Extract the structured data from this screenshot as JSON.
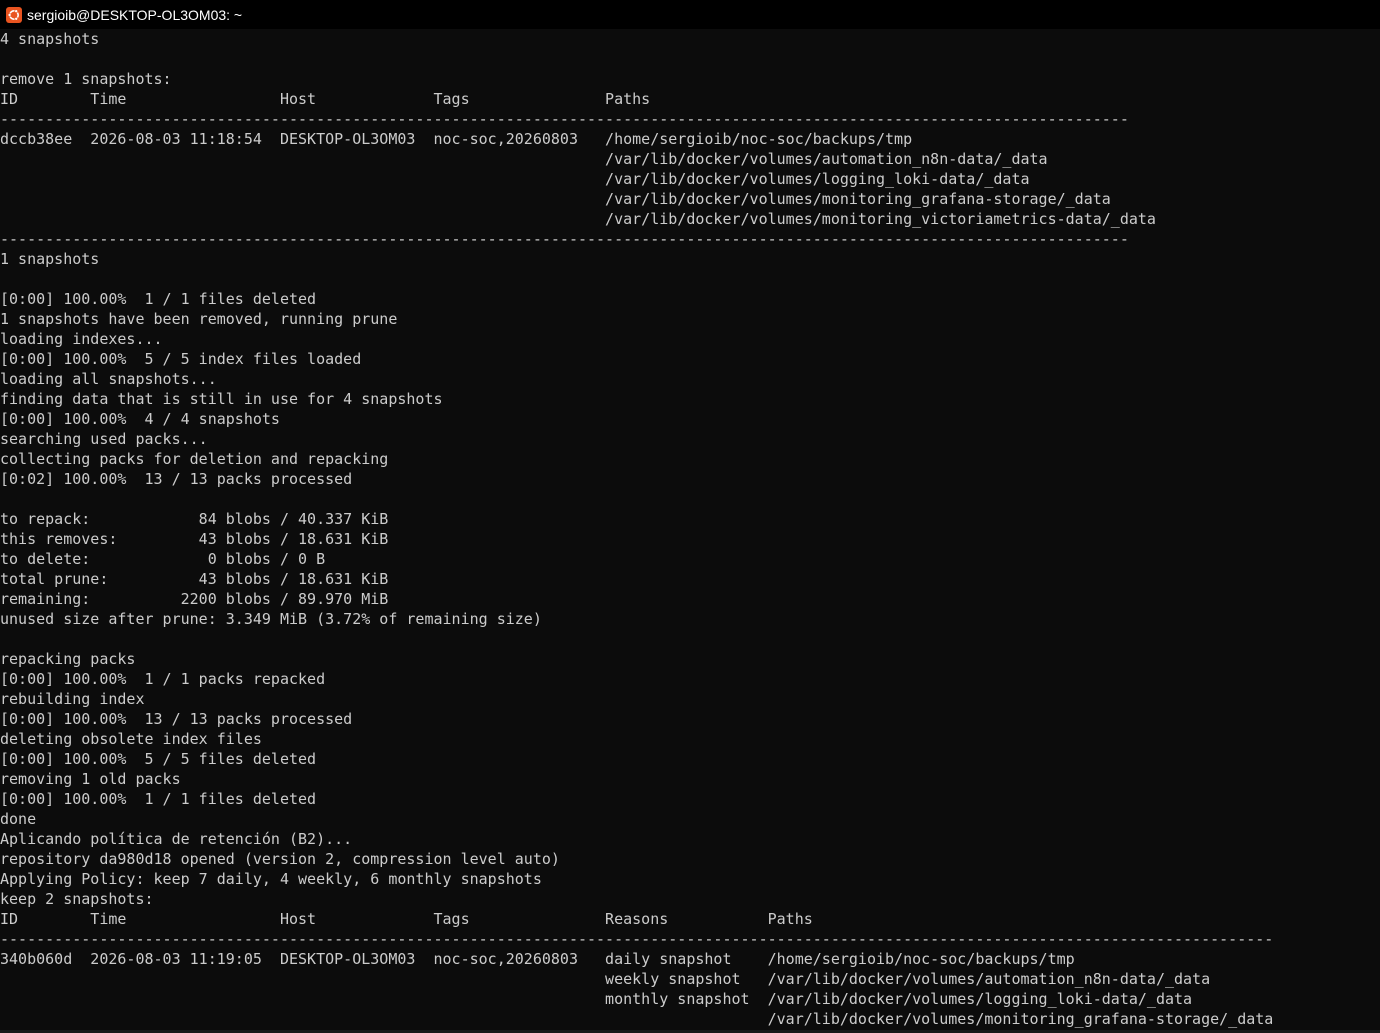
{
  "window": {
    "title": "sergioib@DESKTOP-OL3OM03: ~",
    "icon": "ubuntu-icon",
    "accent": "#e95420",
    "background": "#0c0c0c",
    "foreground": "#cccccc"
  },
  "lines": [
    "4 snapshots",
    "",
    "remove 1 snapshots:",
    "ID        Time                 Host             Tags               Paths",
    "-----------------------------------------------------------------------------------------------------------------------------",
    "dccb38ee  2026-08-03 11:18:54  DESKTOP-OL3OM03  noc-soc,20260803   /home/sergioib/noc-soc/backups/tmp",
    "                                                                   /var/lib/docker/volumes/automation_n8n-data/_data",
    "                                                                   /var/lib/docker/volumes/logging_loki-data/_data",
    "                                                                   /var/lib/docker/volumes/monitoring_grafana-storage/_data",
    "                                                                   /var/lib/docker/volumes/monitoring_victoriametrics-data/_data",
    "-----------------------------------------------------------------------------------------------------------------------------",
    "1 snapshots",
    "",
    "[0:00] 100.00%  1 / 1 files deleted",
    "1 snapshots have been removed, running prune",
    "loading indexes...",
    "[0:00] 100.00%  5 / 5 index files loaded",
    "loading all snapshots...",
    "finding data that is still in use for 4 snapshots",
    "[0:00] 100.00%  4 / 4 snapshots",
    "searching used packs...",
    "collecting packs for deletion and repacking",
    "[0:02] 100.00%  13 / 13 packs processed",
    "",
    "to repack:            84 blobs / 40.337 KiB",
    "this removes:         43 blobs / 18.631 KiB",
    "to delete:             0 blobs / 0 B",
    "total prune:          43 blobs / 18.631 KiB",
    "remaining:          2200 blobs / 89.970 MiB",
    "unused size after prune: 3.349 MiB (3.72% of remaining size)",
    "",
    "repacking packs",
    "[0:00] 100.00%  1 / 1 packs repacked",
    "rebuilding index",
    "[0:00] 100.00%  13 / 13 packs processed",
    "deleting obsolete index files",
    "[0:00] 100.00%  5 / 5 files deleted",
    "removing 1 old packs",
    "[0:00] 100.00%  1 / 1 files deleted",
    "done",
    "Aplicando política de retención (B2)...",
    "repository da980d18 opened (version 2, compression level auto)",
    "Applying Policy: keep 7 daily, 4 weekly, 6 monthly snapshots",
    "keep 2 snapshots:",
    "ID        Time                 Host             Tags               Reasons           Paths",
    "---------------------------------------------------------------------------------------------------------------------------------------------",
    "340b060d  2026-08-03 11:19:05  DESKTOP-OL3OM03  noc-soc,20260803   daily snapshot    /home/sergioib/noc-soc/backups/tmp",
    "                                                                   weekly snapshot   /var/lib/docker/volumes/automation_n8n-data/_data",
    "                                                                   monthly snapshot  /var/lib/docker/volumes/logging_loki-data/_data",
    "                                                                                     /var/lib/docker/volumes/monitoring_grafana-storage/_data"
  ]
}
